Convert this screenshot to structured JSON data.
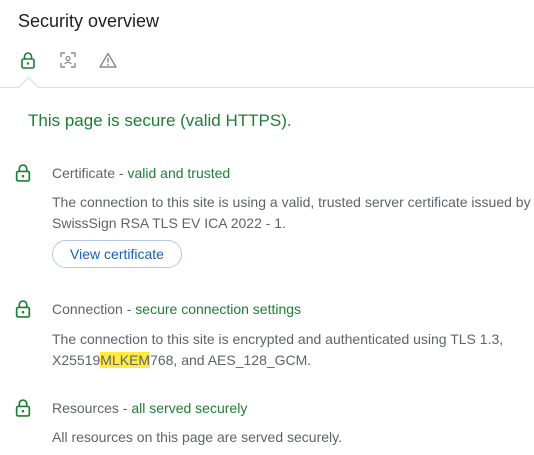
{
  "header": {
    "title": "Security overview"
  },
  "tabs": [
    {
      "icon": "lock-icon",
      "active": true
    },
    {
      "icon": "scan-icon",
      "active": false
    },
    {
      "icon": "warning-icon",
      "active": false
    }
  ],
  "summary": "This page is secure (valid HTTPS).",
  "sections": {
    "certificate": {
      "label": "Certificate",
      "separator": " - ",
      "status": "valid and trusted",
      "description": "The connection to this site is using a valid, trusted server certificate issued by SwissSign RSA TLS EV ICA 2022 - 1.",
      "button_label": "View certificate"
    },
    "connection": {
      "label": "Connection",
      "separator": " - ",
      "status": "secure connection settings",
      "description_line1": "The connection to this site is encrypted and authenticated using TLS 1.3,",
      "description_prefix": "X25519",
      "description_highlight": "MLKEM",
      "description_suffix": "768, and AES_128_GCM."
    },
    "resources": {
      "label": "Resources",
      "separator": " - ",
      "status": "all served securely",
      "description": "All resources on this page are served securely."
    }
  },
  "colors": {
    "secure_green": "#1e7e34",
    "link_blue": "#1a5fb4",
    "highlight": "#ffeb3b",
    "muted_text": "#5f6368"
  }
}
